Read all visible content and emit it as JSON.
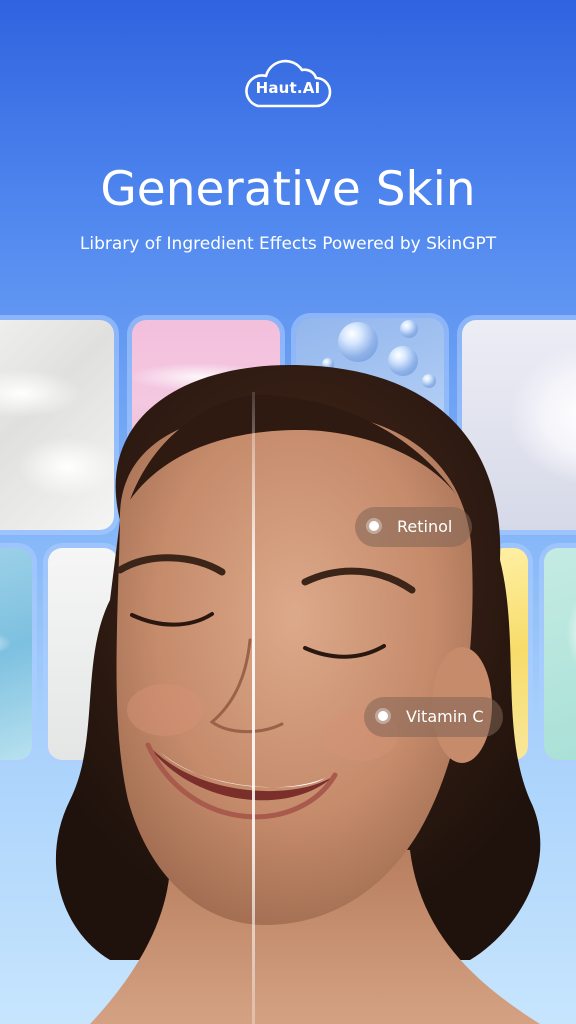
{
  "brand": {
    "logo_text": "Haut.AI"
  },
  "hero": {
    "title": "Generative Skin",
    "subtitle": "Library of Ingredient Effects Powered by SkinGPT"
  },
  "ingredient_tags": [
    {
      "label": "Retinol"
    },
    {
      "label": "Vitamin C"
    }
  ],
  "colors": {
    "background_top": "#2f63df",
    "background_bottom": "#c7e5fd",
    "text": "#ffffff",
    "tag_background": "#826455"
  }
}
